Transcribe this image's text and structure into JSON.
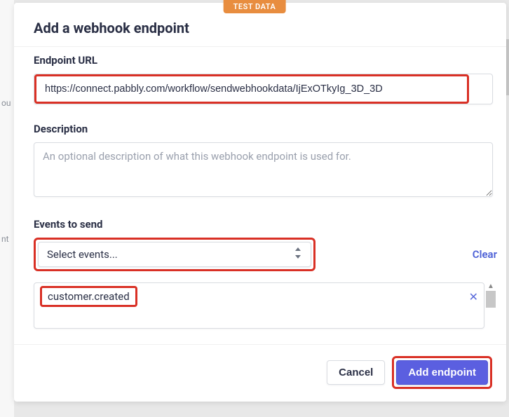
{
  "badge": "TEST DATA",
  "modal": {
    "title": "Add a webhook endpoint",
    "url": {
      "label": "Endpoint URL",
      "value": "https://connect.pabbly.com/workflow/sendwebhookdata/IjExOTkyIg_3D_3D"
    },
    "description": {
      "label": "Description",
      "placeholder": "An optional description of what this webhook endpoint is used for."
    },
    "events": {
      "label": "Events to send",
      "select_placeholder": "Select events...",
      "clear_label": "Clear",
      "selected": [
        "customer.created"
      ]
    },
    "buttons": {
      "cancel": "Cancel",
      "submit": "Add endpoint"
    }
  }
}
